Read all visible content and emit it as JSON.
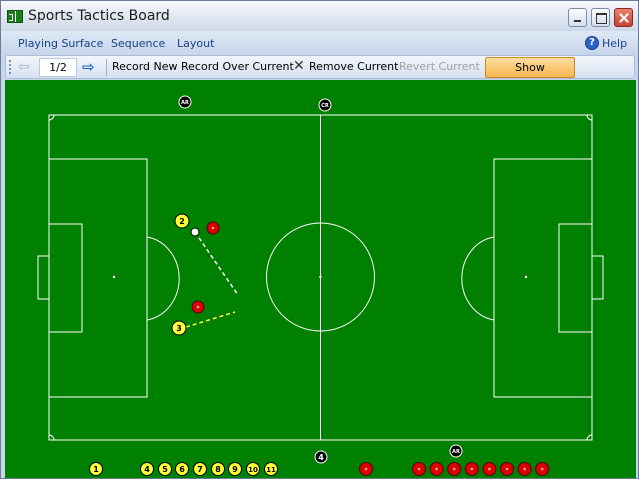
{
  "window": {
    "title": "Sports Tactics Board",
    "icon": "pitch-icon"
  },
  "menu": {
    "items": [
      "Playing Surface",
      "Sequence",
      "Layout"
    ],
    "help_label": "Help"
  },
  "toolbar": {
    "page": "1/2",
    "record_new": "Record New",
    "record_over": "Record Over Current",
    "remove_current": "Remove Current",
    "revert_current": "Revert Current",
    "show_movement": "Show Movement"
  },
  "board": {
    "background": "#008000",
    "line_color": "#ffffff",
    "yellow": "#ffff33",
    "red": "#dd0000",
    "black": "#000000",
    "field_tokens": [
      {
        "label": "AR",
        "color": "black"
      },
      {
        "label": "CR",
        "color": "black"
      },
      {
        "label": "2",
        "color": "yellow"
      },
      {
        "label": "",
        "color": "red"
      },
      {
        "label": "",
        "color": "white-ball"
      },
      {
        "label": "",
        "color": "red"
      },
      {
        "label": "3",
        "color": "yellow"
      },
      {
        "label": "4",
        "color": "black"
      },
      {
        "label": "AR",
        "color": "black"
      }
    ],
    "bench_yellow": [
      "1",
      "4",
      "5",
      "6",
      "7",
      "8",
      "9",
      "10",
      "11"
    ],
    "bench_red_count": 8,
    "bench_red_single_count": 1
  }
}
